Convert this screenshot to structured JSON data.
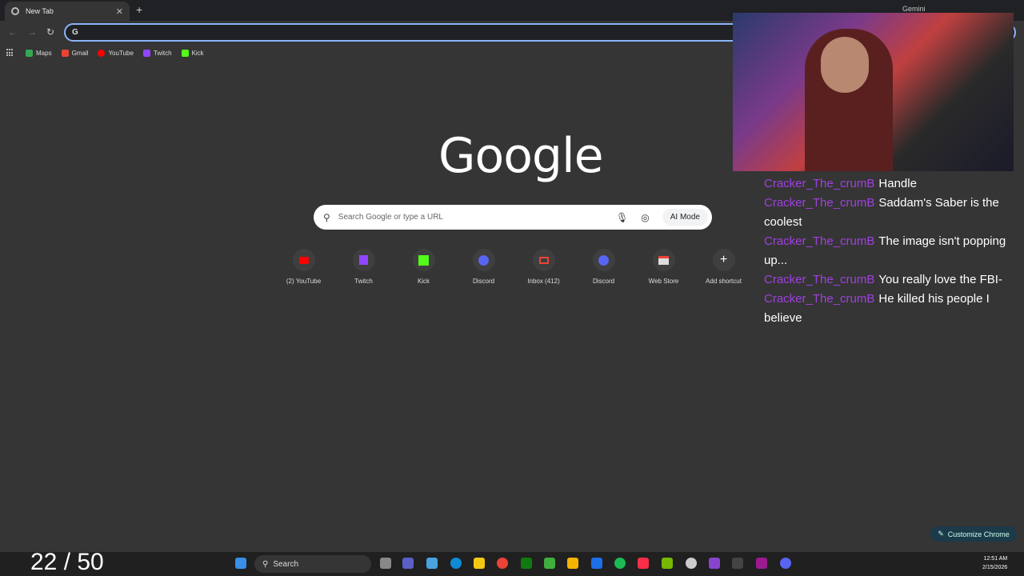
{
  "browser": {
    "tab_title": "New Tab",
    "gemini_label": "Gemini",
    "omnibox_value": ""
  },
  "bookmarks": [
    {
      "label": "Maps",
      "color": "#34a853"
    },
    {
      "label": "Gmail",
      "color": "#ea4335"
    },
    {
      "label": "YouTube",
      "color": "#ff0000"
    },
    {
      "label": "Twitch",
      "color": "#9146ff"
    },
    {
      "label": "Kick",
      "color": "#53fc18"
    }
  ],
  "page": {
    "logo": "Google",
    "search_placeholder": "Search Google or type a URL",
    "ai_mode_label": "AI Mode"
  },
  "shortcuts": [
    {
      "label": "(2) YouTube",
      "color": "#ff0000"
    },
    {
      "label": "Twitch",
      "color": "#9146ff"
    },
    {
      "label": "Kick",
      "color": "#53fc18"
    },
    {
      "label": "Discord",
      "color": "#5865f2"
    },
    {
      "label": "Inbox (412)",
      "color": "#ea4335"
    },
    {
      "label": "Discord",
      "color": "#5865f2"
    },
    {
      "label": "Web Store",
      "color": "#e8eaed"
    },
    {
      "label": "Add shortcut",
      "color": "#e8eaed"
    }
  ],
  "chat": [
    {
      "user": "Cracker_The_crumB",
      "text": "Handle"
    },
    {
      "user": "Cracker_The_crumB",
      "text": "Saddam's Saber is the coolest"
    },
    {
      "user": "Cracker_The_crumB",
      "text": "The image isn't popping up..."
    },
    {
      "user": "Cracker_The_crumB",
      "text": "You really love the FBI-"
    },
    {
      "user": "Cracker_The_crumB",
      "text": "He killed his people I believe"
    }
  ],
  "customize_label": "Customize Chrome",
  "overlay_counter": "22 / 50",
  "taskbar": {
    "search_label": "Search",
    "time": "12:51 AM",
    "date": "2/15/2026"
  }
}
